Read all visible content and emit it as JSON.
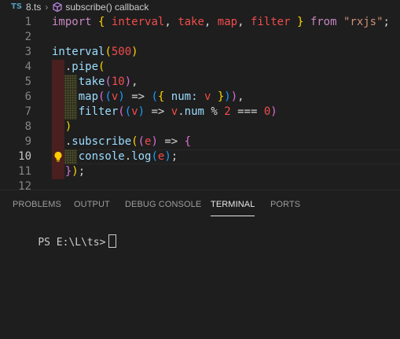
{
  "breadcrumb": {
    "lang_badge": "TS",
    "file": "8.ts",
    "separator": "›",
    "symbol": "subscribe() callback"
  },
  "editor": {
    "active_line": 10,
    "lines": [
      {
        "n": "1",
        "tokens": [
          {
            "t": "import",
            "c": "kw"
          },
          {
            "t": " ",
            "c": "op"
          },
          {
            "t": "{",
            "c": "yb"
          },
          {
            "t": " ",
            "c": "op"
          },
          {
            "t": "interval",
            "c": "red"
          },
          {
            "t": ", ",
            "c": "op"
          },
          {
            "t": "take",
            "c": "red"
          },
          {
            "t": ", ",
            "c": "op"
          },
          {
            "t": "map",
            "c": "red"
          },
          {
            "t": ", ",
            "c": "op"
          },
          {
            "t": "filter",
            "c": "red"
          },
          {
            "t": " ",
            "c": "op"
          },
          {
            "t": "}",
            "c": "yb"
          },
          {
            "t": " ",
            "c": "op"
          },
          {
            "t": "from",
            "c": "kw"
          },
          {
            "t": " ",
            "c": "op"
          },
          {
            "t": "\"rxjs\"",
            "c": "str"
          },
          {
            "t": ";",
            "c": "op"
          }
        ]
      },
      {
        "n": "2",
        "tokens": []
      },
      {
        "n": "3",
        "tokens": [
          {
            "t": "interval",
            "c": "var"
          },
          {
            "t": "(",
            "c": "yb"
          },
          {
            "t": "500",
            "c": "red"
          },
          {
            "t": ")",
            "c": "yb"
          }
        ]
      },
      {
        "n": "4",
        "tokens": [
          {
            "t": "  .",
            "c": "op"
          },
          {
            "t": "pipe",
            "c": "var"
          },
          {
            "t": "(",
            "c": "yb"
          }
        ]
      },
      {
        "n": "5",
        "tokens": [
          {
            "t": "    ",
            "c": "op"
          },
          {
            "t": "take",
            "c": "var"
          },
          {
            "t": "(",
            "c": "pb"
          },
          {
            "t": "10",
            "c": "red"
          },
          {
            "t": ")",
            "c": "pb"
          },
          {
            "t": ",",
            "c": "op"
          }
        ]
      },
      {
        "n": "6",
        "tokens": [
          {
            "t": "    ",
            "c": "op"
          },
          {
            "t": "map",
            "c": "var"
          },
          {
            "t": "(",
            "c": "pb"
          },
          {
            "t": "(",
            "c": "bb"
          },
          {
            "t": "v",
            "c": "red"
          },
          {
            "t": ")",
            "c": "bb"
          },
          {
            "t": " => ",
            "c": "op"
          },
          {
            "t": "(",
            "c": "bb"
          },
          {
            "t": "{",
            "c": "yb"
          },
          {
            "t": " num: ",
            "c": "var"
          },
          {
            "t": "v",
            "c": "red"
          },
          {
            "t": " ",
            "c": "op"
          },
          {
            "t": "}",
            "c": "yb"
          },
          {
            "t": ")",
            "c": "bb"
          },
          {
            "t": ")",
            "c": "pb"
          },
          {
            "t": ",",
            "c": "op"
          }
        ]
      },
      {
        "n": "7",
        "tokens": [
          {
            "t": "    ",
            "c": "op"
          },
          {
            "t": "filter",
            "c": "var"
          },
          {
            "t": "(",
            "c": "pb"
          },
          {
            "t": "(",
            "c": "bb"
          },
          {
            "t": "v",
            "c": "red"
          },
          {
            "t": ")",
            "c": "bb"
          },
          {
            "t": " => ",
            "c": "op"
          },
          {
            "t": "v",
            "c": "red"
          },
          {
            "t": ".",
            "c": "op"
          },
          {
            "t": "num",
            "c": "var"
          },
          {
            "t": " % ",
            "c": "op"
          },
          {
            "t": "2",
            "c": "red"
          },
          {
            "t": " === ",
            "c": "op"
          },
          {
            "t": "0",
            "c": "red"
          },
          {
            "t": ")",
            "c": "pb"
          }
        ]
      },
      {
        "n": "8",
        "tokens": [
          {
            "t": "  ",
            "c": "op"
          },
          {
            "t": ")",
            "c": "yb"
          }
        ]
      },
      {
        "n": "9",
        "tokens": [
          {
            "t": "  .",
            "c": "op"
          },
          {
            "t": "subscribe",
            "c": "var"
          },
          {
            "t": "(",
            "c": "yb"
          },
          {
            "t": "(",
            "c": "pb"
          },
          {
            "t": "e",
            "c": "red"
          },
          {
            "t": ")",
            "c": "pb"
          },
          {
            "t": " => ",
            "c": "op"
          },
          {
            "t": "{",
            "c": "pb"
          }
        ]
      },
      {
        "n": "10",
        "tokens": [
          {
            "t": "    ",
            "c": "op"
          },
          {
            "t": "console",
            "c": "var"
          },
          {
            "t": ".",
            "c": "op"
          },
          {
            "t": "log",
            "c": "var"
          },
          {
            "t": "(",
            "c": "bb"
          },
          {
            "t": "e",
            "c": "red"
          },
          {
            "t": ")",
            "c": "bb"
          },
          {
            "t": ";",
            "c": "op"
          }
        ]
      },
      {
        "n": "11",
        "tokens": [
          {
            "t": "  ",
            "c": "op"
          },
          {
            "t": "}",
            "c": "pb"
          },
          {
            "t": ")",
            "c": "yb"
          },
          {
            "t": ";",
            "c": "op"
          }
        ]
      },
      {
        "n": "12",
        "tokens": []
      }
    ]
  },
  "panel": {
    "tabs": [
      "PROBLEMS",
      "OUTPUT",
      "DEBUG CONSOLE",
      "TERMINAL",
      "PORTS"
    ],
    "active_tab": "TERMINAL",
    "terminal_prompt": "PS E:\\L\\ts>"
  },
  "colors": {
    "background": "#1e1e1e",
    "keyword": "#c586c0",
    "variable": "#9cdcfe",
    "string": "#ce9178",
    "bracket_yellow": "#ffd700",
    "bracket_purple": "#da70d6",
    "bracket_blue": "#179fff",
    "error_red": "#f14c4c",
    "lightbulb": "#ffcc00"
  }
}
